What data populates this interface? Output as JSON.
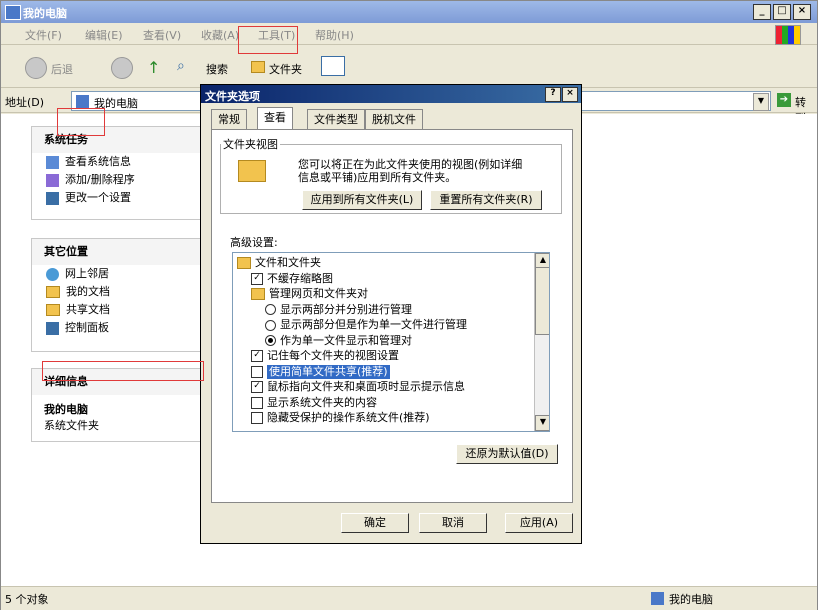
{
  "window": {
    "title": "我的电脑",
    "controls": [
      "_",
      "□",
      "×"
    ]
  },
  "menu": [
    "文件(F)",
    "编辑(E)",
    "查看(V)",
    "收藏(A)",
    "工具(T)",
    "帮助(H)"
  ],
  "toolbar": {
    "back": "后退",
    "search": "搜索",
    "folders": "文件夹"
  },
  "address": {
    "label": "地址(D)",
    "value": "我的电脑",
    "go": "转到"
  },
  "left_panels": {
    "tasks": {
      "title": "系统任务",
      "items": [
        "查看系统信息",
        "添加/删除程序",
        "更改一个设置"
      ]
    },
    "places": {
      "title": "其它位置",
      "items": [
        "网上邻居",
        "我的文档",
        "共享文档",
        "控制面板"
      ]
    },
    "details": {
      "title": "详细信息",
      "name": "我的电脑",
      "desc": "系统文件夹"
    }
  },
  "status": {
    "left": "5 个对象",
    "right": "我的电脑"
  },
  "dialog": {
    "title": "文件夹选项",
    "help": "?",
    "close": "×",
    "tabs": [
      "常规",
      "查看",
      "文件类型",
      "脱机文件"
    ],
    "active_tab": "查看",
    "views_group": {
      "legend": "文件夹视图",
      "desc_line1": "您可以将正在为此文件夹使用的视图(例如详细",
      "desc_line2": "信息或平铺)应用到所有文件夹。",
      "apply_all": "应用到所有文件夹(L)",
      "reset_all": "重置所有文件夹(R)"
    },
    "advanced_label": "高级设置:",
    "tree": [
      {
        "type": "folder",
        "label": "文件和文件夹",
        "indent": 0
      },
      {
        "type": "check",
        "checked": true,
        "label": "不缓存缩略图",
        "indent": 1
      },
      {
        "type": "folder",
        "label": "管理网页和文件夹对",
        "indent": 1
      },
      {
        "type": "radio",
        "checked": false,
        "label": "显示两部分并分别进行管理",
        "indent": 2
      },
      {
        "type": "radio",
        "checked": false,
        "label": "显示两部分但是作为单一文件进行管理",
        "indent": 2
      },
      {
        "type": "radio",
        "checked": true,
        "label": "作为单一文件显示和管理对",
        "indent": 2
      },
      {
        "type": "check",
        "checked": true,
        "label": "记住每个文件夹的视图设置",
        "indent": 1
      },
      {
        "type": "check",
        "checked": false,
        "label": "使用简单文件共享(推荐)",
        "indent": 1,
        "selected": true
      },
      {
        "type": "check",
        "checked": true,
        "label": "鼠标指向文件夹和桌面项时显示提示信息",
        "indent": 1
      },
      {
        "type": "check",
        "checked": false,
        "label": "显示系统文件夹的内容",
        "indent": 1
      },
      {
        "type": "check",
        "checked": false,
        "label": "隐藏受保护的操作系统文件(推荐)",
        "indent": 1
      }
    ],
    "restore_defaults": "还原为默认值(D)",
    "ok": "确定",
    "cancel": "取消",
    "apply": "应用(A)"
  }
}
